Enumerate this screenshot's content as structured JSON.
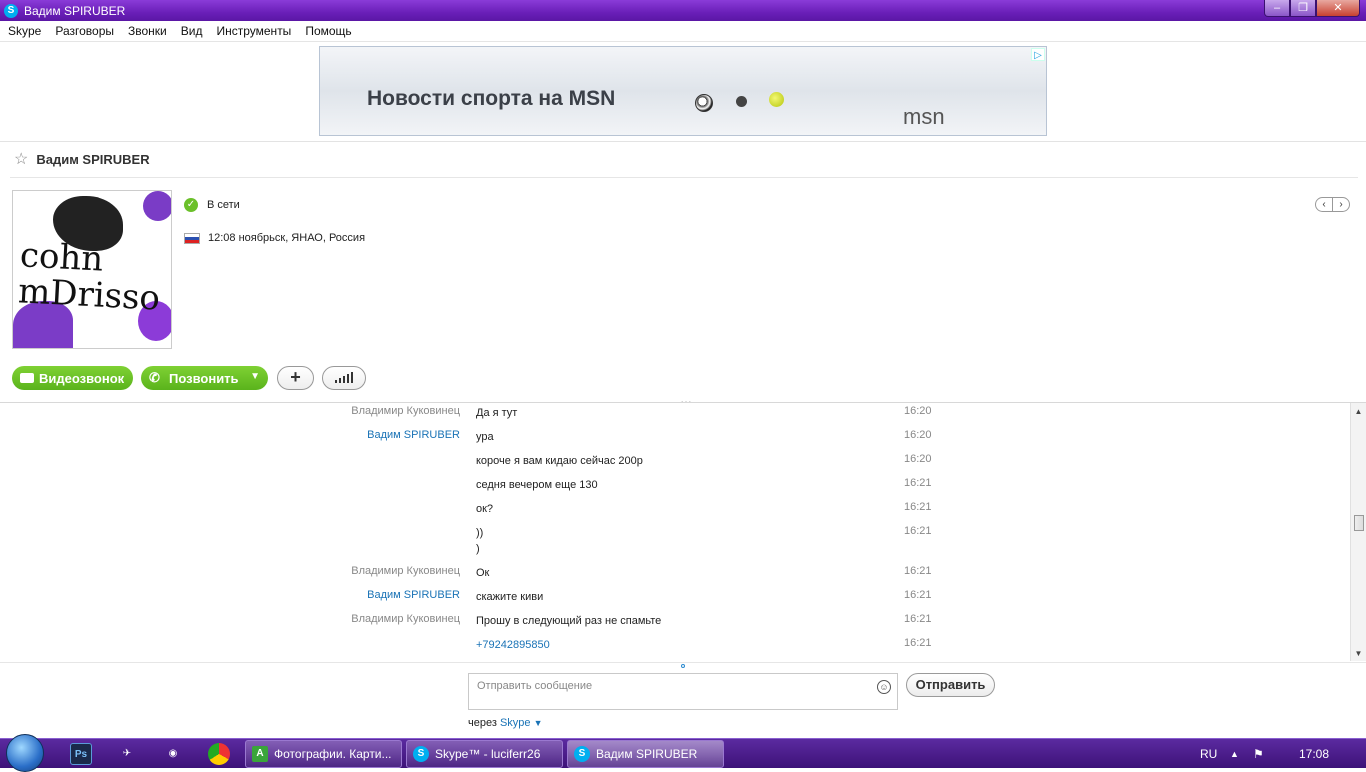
{
  "window": {
    "title": "Вадим SPIRUBER",
    "app_icon": "skype-icon"
  },
  "menu": [
    "Skype",
    "Разговоры",
    "Звонки",
    "Вид",
    "Инструменты",
    "Помощь"
  ],
  "ad": {
    "text": "Новости спорта на MSN",
    "brand": "msn"
  },
  "contact": {
    "name": "Вадим SPIRUBER",
    "avatar_text": "cohn\nmDrisso",
    "status": "В сети",
    "local_info": "12:08 ноябрьск, ЯНАО, Россия"
  },
  "actions": {
    "video_call": "Видеозвонок",
    "call": "Позвонить",
    "add": "+"
  },
  "messages": [
    {
      "sender": "Владимир Куковинец",
      "who": "other",
      "text": "Да я тут",
      "time": "16:20"
    },
    {
      "sender": "Вадим SPIRUBER",
      "who": "me",
      "text": "ура",
      "time": "16:20"
    },
    {
      "sender": "",
      "who": "me",
      "text": "короче я вам кидаю сейчас 200р",
      "time": "16:20"
    },
    {
      "sender": "",
      "who": "me",
      "text": "седня вечером еще 130",
      "time": "16:21"
    },
    {
      "sender": "",
      "who": "me",
      "text": "ок?",
      "time": "16:21"
    },
    {
      "sender": "",
      "who": "me",
      "text": "))\n)",
      "time": "16:21"
    },
    {
      "sender": "Владимир Куковинец",
      "who": "other",
      "text": "Ок",
      "time": "16:21"
    },
    {
      "sender": "Вадим SPIRUBER",
      "who": "me",
      "text": "скажите киви",
      "time": "16:21"
    },
    {
      "sender": "Владимир Куковинец",
      "who": "other",
      "text": "Прошу в следующий раз не спамьте",
      "time": "16:21"
    },
    {
      "sender": "",
      "who": "other",
      "text": "+79242895850",
      "time": "16:21",
      "link": true
    }
  ],
  "compose": {
    "placeholder": "Отправить сообщение",
    "send": "Отправить",
    "via_prefix": "через",
    "via_link": "Skype"
  },
  "taskbar": {
    "tasks": [
      {
        "label": "Фотографии. Карти...",
        "icon": "app-a-icon"
      },
      {
        "label": "Skype™ - luciferr26",
        "icon": "skype-icon"
      },
      {
        "label": "Вадим SPIRUBER",
        "icon": "skype-icon",
        "active": true
      }
    ],
    "lang": "RU",
    "clock": "17:08"
  },
  "colors": {
    "accent_green": "#5ab31c",
    "link_blue": "#1a73b6",
    "title_purple": "#6a1fb8"
  }
}
